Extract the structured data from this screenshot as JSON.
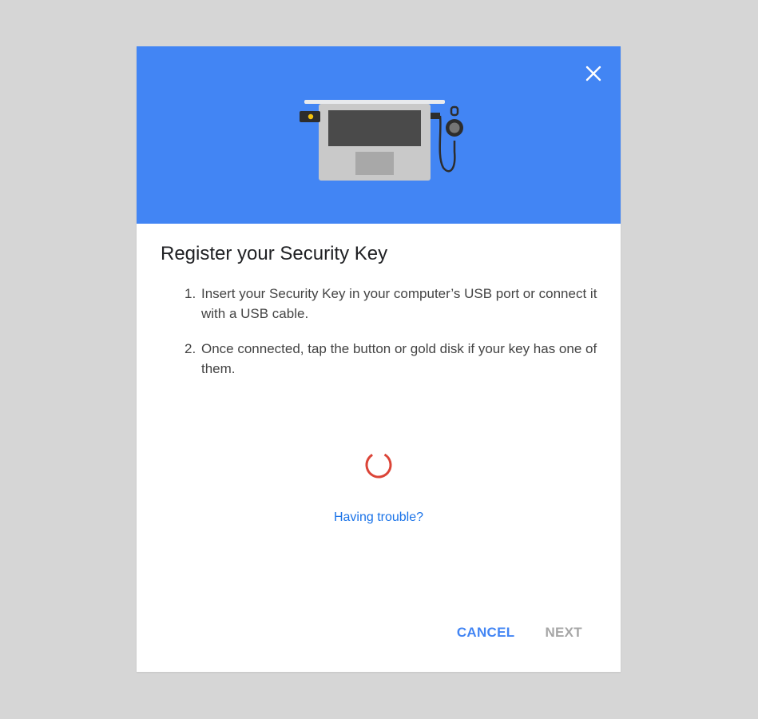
{
  "dialog": {
    "title": "Register your Security Key",
    "steps": [
      {
        "number": "1.",
        "text": "Insert your Security Key in your computer’s USB port or connect it with a USB cable."
      },
      {
        "number": "2.",
        "text": "Once connected, tap the button or gold disk if your key has one of them."
      }
    ],
    "trouble_link": "Having trouble?",
    "cancel_label": "CANCEL",
    "next_label": "NEXT"
  },
  "icons": {
    "close": "close-icon",
    "spinner": "loading-spinner-icon",
    "illustration": "laptop-security-key-illustration"
  },
  "colors": {
    "banner": "#4285f4",
    "accent": "#4285f4",
    "link": "#1a73e8",
    "spinner": "#db4437",
    "disabled": "#a6a6a6"
  }
}
